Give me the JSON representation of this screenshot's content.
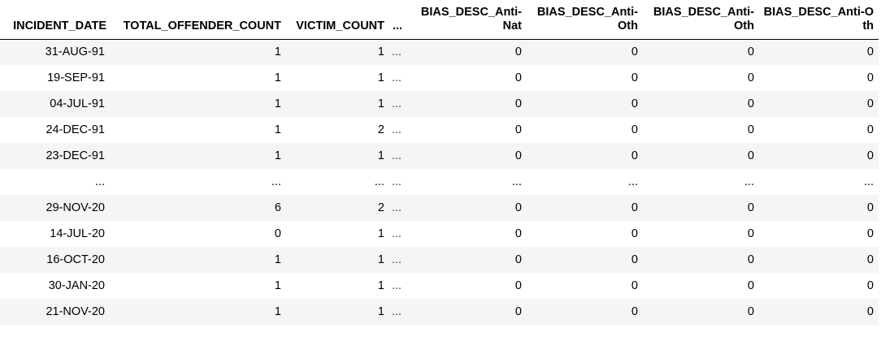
{
  "table": {
    "columns": [
      "INCIDENT_DATE",
      "TOTAL_OFFENDER_COUNT",
      "VICTIM_COUNT",
      "...",
      "BIAS_DESC_Anti-Nat",
      "BIAS_DESC_Anti-Oth",
      "BIAS_DESC_Anti-Oth",
      "BIAS_DESC_Anti-Oth"
    ],
    "rows": [
      [
        "31-AUG-91",
        "1",
        "1",
        "...",
        "0",
        "0",
        "0",
        "0"
      ],
      [
        "19-SEP-91",
        "1",
        "1",
        "...",
        "0",
        "0",
        "0",
        "0"
      ],
      [
        "04-JUL-91",
        "1",
        "1",
        "...",
        "0",
        "0",
        "0",
        "0"
      ],
      [
        "24-DEC-91",
        "1",
        "2",
        "...",
        "0",
        "0",
        "0",
        "0"
      ],
      [
        "23-DEC-91",
        "1",
        "1",
        "...",
        "0",
        "0",
        "0",
        "0"
      ],
      [
        "...",
        "...",
        "...",
        "...",
        "...",
        "...",
        "...",
        "..."
      ],
      [
        "29-NOV-20",
        "6",
        "2",
        "...",
        "0",
        "0",
        "0",
        "0"
      ],
      [
        "14-JUL-20",
        "0",
        "1",
        "...",
        "0",
        "0",
        "0",
        "0"
      ],
      [
        "16-OCT-20",
        "1",
        "1",
        "...",
        "0",
        "0",
        "0",
        "0"
      ],
      [
        "30-JAN-20",
        "1",
        "1",
        "...",
        "0",
        "0",
        "0",
        "0"
      ],
      [
        "21-NOV-20",
        "1",
        "1",
        "...",
        "0",
        "0",
        "0",
        "0"
      ]
    ]
  }
}
